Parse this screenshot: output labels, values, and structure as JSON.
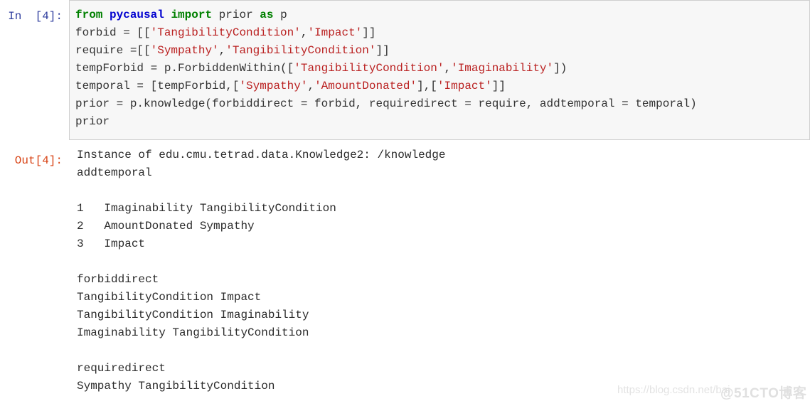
{
  "notebook": {
    "input_cell": {
      "prompt": "In  [4]:",
      "language": "python",
      "code_lines": [
        [
          {
            "t": "from ",
            "c": "kw"
          },
          {
            "t": "pycausal ",
            "c": "mod"
          },
          {
            "t": "import ",
            "c": "kw"
          },
          {
            "t": "prior ",
            "c": "pl"
          },
          {
            "t": "as ",
            "c": "kw"
          },
          {
            "t": "p",
            "c": "pl"
          }
        ],
        [
          {
            "t": "forbid = [[",
            "c": "pl"
          },
          {
            "t": "'TangibilityCondition'",
            "c": "str"
          },
          {
            "t": ",",
            "c": "pl"
          },
          {
            "t": "'Impact'",
            "c": "str"
          },
          {
            "t": "]]",
            "c": "pl"
          }
        ],
        [
          {
            "t": "require =[[",
            "c": "pl"
          },
          {
            "t": "'Sympathy'",
            "c": "str"
          },
          {
            "t": ",",
            "c": "pl"
          },
          {
            "t": "'TangibilityCondition'",
            "c": "str"
          },
          {
            "t": "]]",
            "c": "pl"
          }
        ],
        [
          {
            "t": "tempForbid = p.ForbiddenWithin([",
            "c": "pl"
          },
          {
            "t": "'TangibilityCondition'",
            "c": "str"
          },
          {
            "t": ",",
            "c": "pl"
          },
          {
            "t": "'Imaginability'",
            "c": "str"
          },
          {
            "t": "])",
            "c": "pl"
          }
        ],
        [
          {
            "t": "temporal = [tempForbid,[",
            "c": "pl"
          },
          {
            "t": "'Sympathy'",
            "c": "str"
          },
          {
            "t": ",",
            "c": "pl"
          },
          {
            "t": "'AmountDonated'",
            "c": "str"
          },
          {
            "t": "],[",
            "c": "pl"
          },
          {
            "t": "'Impact'",
            "c": "str"
          },
          {
            "t": "]]",
            "c": "pl"
          }
        ],
        [
          {
            "t": "prior = p.knowledge(forbiddirect = forbid, requiredirect = require, addtemporal = temporal)",
            "c": "pl"
          }
        ],
        [
          {
            "t": "prior",
            "c": "pl"
          }
        ]
      ],
      "plain_code": "from pycausal import prior as p\nforbid = [['TangibilityCondition','Impact']]\nrequire =[['Sympathy','TangibilityCondition']]\ntempForbid = p.ForbiddenWithin(['TangibilityCondition','Imaginability'])\ntemporal = [tempForbid,['Sympathy','AmountDonated'],['Impact']]\nprior = p.knowledge(forbiddirect = forbid, requiredirect = require, addtemporal = temporal)\nprior"
    },
    "output_cell": {
      "prompt": "Out[4]:",
      "lines": [
        "Instance of edu.cmu.tetrad.data.Knowledge2: /knowledge",
        "addtemporal",
        "",
        "1   Imaginability TangibilityCondition",
        "2   AmountDonated Sympathy",
        "3   Impact",
        "",
        "forbiddirect",
        "TangibilityCondition Impact",
        "TangibilityCondition Imaginability",
        "Imaginability TangibilityCondition",
        "",
        "requiredirect",
        "Sympathy TangibilityCondition"
      ]
    }
  },
  "watermarks": {
    "url": "https://blog.csdn.net/bai",
    "brand": "@51CTO博客"
  },
  "colors": {
    "keyword": "#008000",
    "module": "#0000cf",
    "string": "#ba2121",
    "plain": "#333333",
    "prompt_in": "#303f9f",
    "prompt_out": "#d84315",
    "cell_bg": "#f7f7f7",
    "cell_border": "#cfcfcf",
    "page_bg": "#ffffff"
  }
}
